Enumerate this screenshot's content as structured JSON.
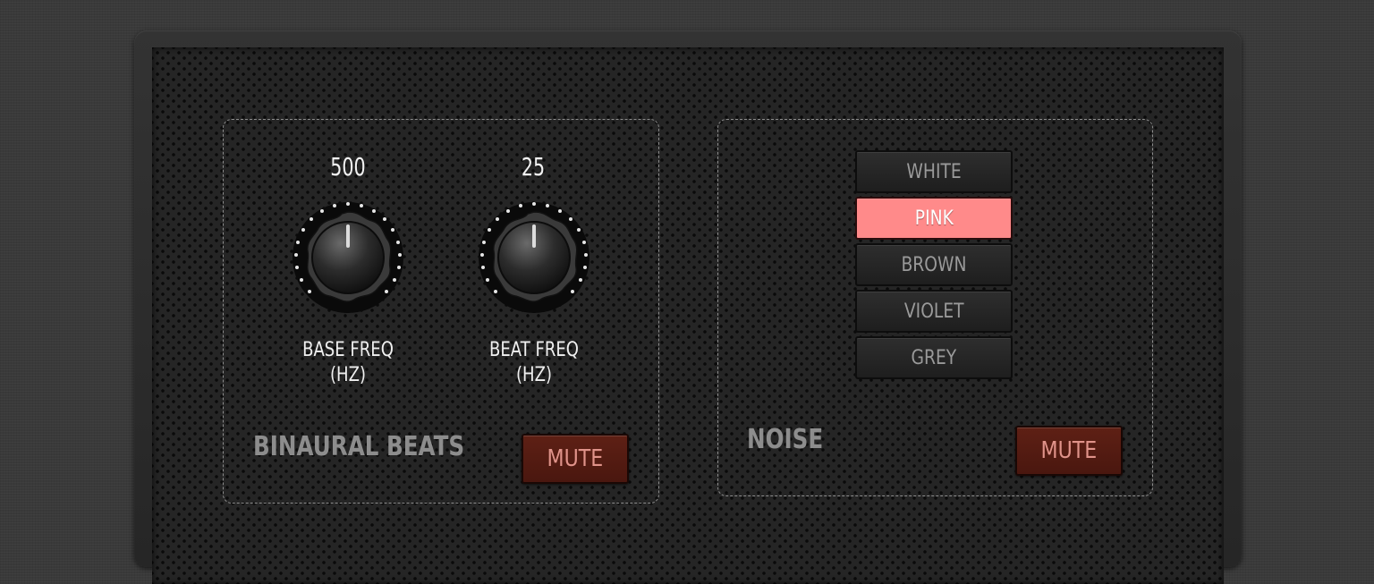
{
  "binaural": {
    "title": "BINAURAL BEATS",
    "mute_label": "MUTE",
    "knobs": [
      {
        "value": "500",
        "label_line1": "BASE FREQ",
        "label_line2": "(HZ)"
      },
      {
        "value": "25",
        "label_line1": "BEAT FREQ",
        "label_line2": "(HZ)"
      }
    ]
  },
  "noise": {
    "title": "NOISE",
    "mute_label": "MUTE",
    "options": [
      "WHITE",
      "PINK",
      "BROWN",
      "VIOLET",
      "GREY"
    ],
    "selected": "PINK"
  },
  "colors": {
    "accent_selected": "#ff8a8a",
    "mute_bg": "#5e2015",
    "mute_text": "#e0938a"
  },
  "icons": [
    "rotary-knob-icon"
  ]
}
